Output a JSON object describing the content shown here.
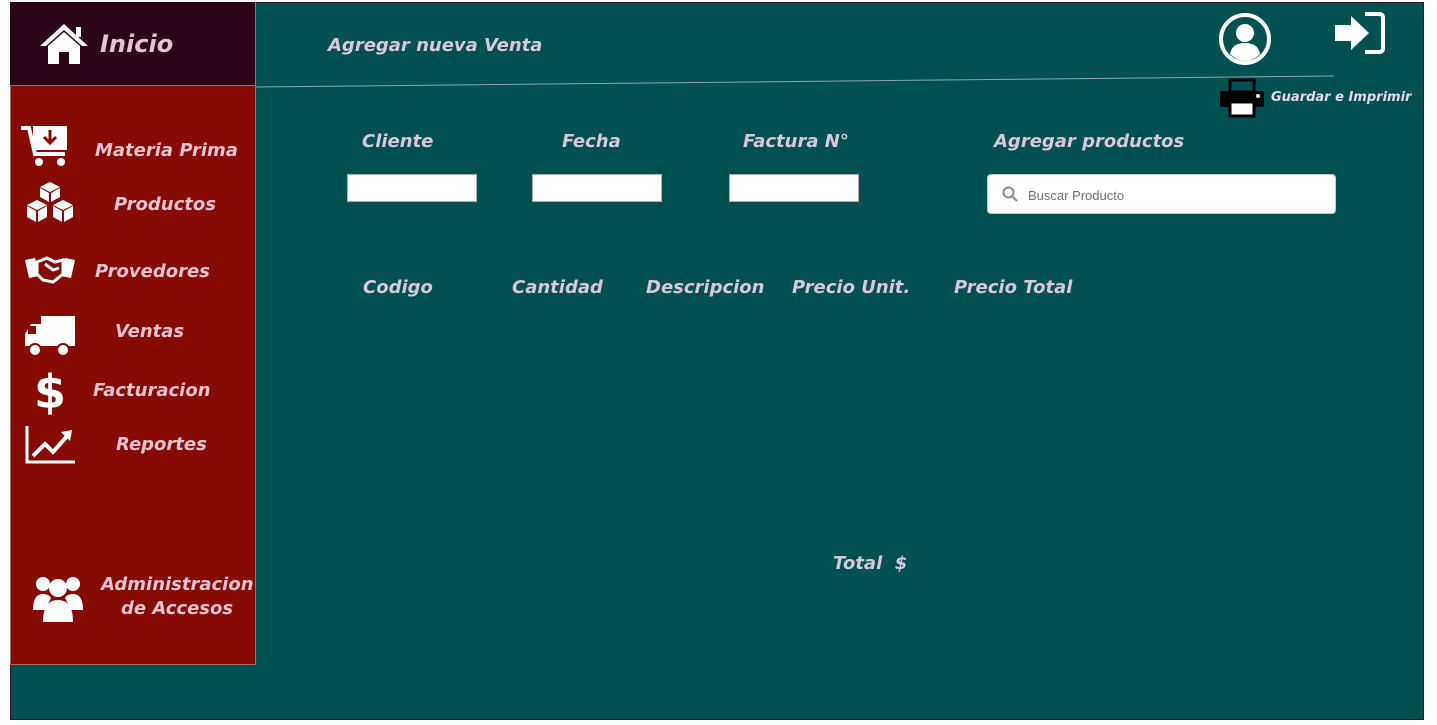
{
  "home": {
    "label": "Inicio",
    "icon": "home-icon"
  },
  "sidebar": {
    "items": [
      {
        "label": "Materia Prima",
        "icon": "cart-download-icon"
      },
      {
        "label": "Productos",
        "icon": "boxes-icon"
      },
      {
        "label": "Provedores",
        "icon": "handshake-icon"
      },
      {
        "label": "Ventas",
        "icon": "truck-icon"
      },
      {
        "label": "Facturacion",
        "icon": "dollar-icon"
      },
      {
        "label": "Reportes",
        "icon": "chart-line-icon"
      }
    ],
    "admin": {
      "line1": "Administracion",
      "line2": "de Accesos",
      "icon": "users-icon"
    }
  },
  "header": {
    "title": "Agregar nueva Venta",
    "print_label": "Guardar e Imprimir"
  },
  "form": {
    "cliente_label": "Cliente",
    "fecha_label": "Fecha",
    "factura_label": "Factura N°",
    "productos_label": "Agregar productos",
    "search_placeholder": "Buscar Producto"
  },
  "table": {
    "columns": [
      "Codigo",
      "Cantidad",
      "Descripcion",
      "Precio Unit.",
      "Precio Total"
    ]
  },
  "total_label": "Total  $",
  "colors": {
    "background": "#025050",
    "sidebar": "#860b03",
    "home_box": "#2d0418",
    "label_text": "#d8c8d8"
  }
}
